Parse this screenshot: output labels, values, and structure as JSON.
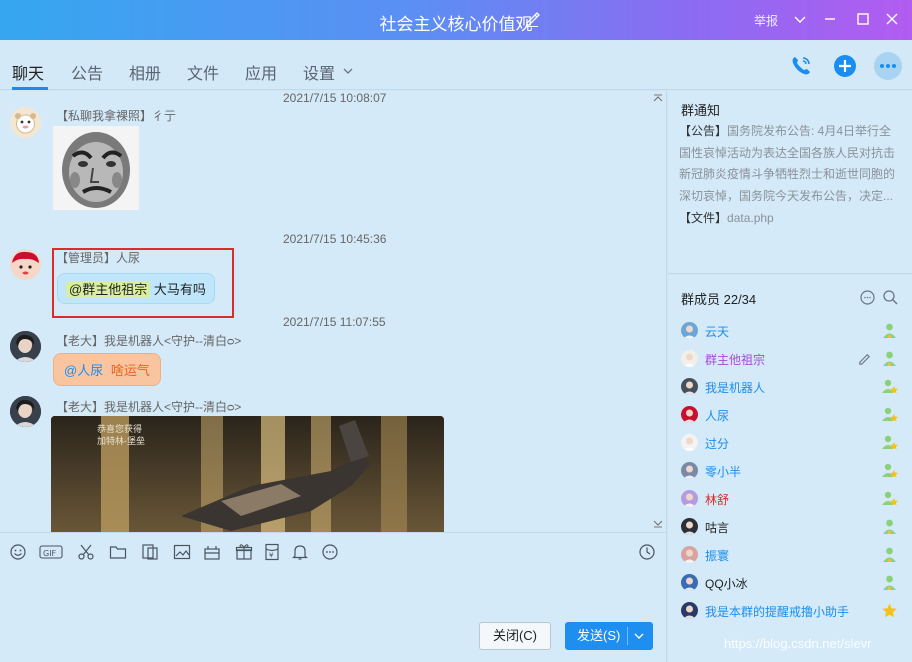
{
  "titlebar": {
    "title": "社会主义核心价值观",
    "report": "举报",
    "colors": {
      "gradient_start": "#35a7f0",
      "gradient_end": "#b25cf0"
    }
  },
  "tabs": [
    {
      "label": "聊天",
      "active": true
    },
    {
      "label": "公告"
    },
    {
      "label": "相册"
    },
    {
      "label": "文件"
    },
    {
      "label": "应用"
    },
    {
      "label": "设置"
    }
  ],
  "chat": {
    "messages": [
      {
        "time": "2021/7/15 10:08:07",
        "sender": "【私聊我拿裸照】彳亍",
        "type": "sticker"
      },
      {
        "time": "2021/7/15 10:45:36",
        "sender": "【管理员】人尿",
        "mention": "@群主他祖宗",
        "text": "大马有吗"
      },
      {
        "time": "2021/7/15 11:07:55",
        "sender": "【老大】我是机器人<守护--清白ᴑ>",
        "mention": "@人尿",
        "text": "啥运气"
      },
      {
        "sender": "【老大】我是机器人<守护--清白ᴑ>",
        "type": "image",
        "image_caption_1": "恭喜您获得",
        "image_caption_2": "加特林-堡垒"
      }
    ]
  },
  "toolbar_icons": [
    "emoji-icon",
    "gif-icon",
    "scissors-icon",
    "folder-icon",
    "screenshot-icon",
    "image-icon",
    "gift-box-icon",
    "present-icon",
    "red-packet-icon",
    "bell-icon",
    "more-icon",
    "history-icon"
  ],
  "buttons": {
    "close": "关闭(C)",
    "send": "发送(S)"
  },
  "notice": {
    "title": "群通知",
    "announcement_tag": "【公告】",
    "announcement_text": "国务院发布公告: 4月4日举行全国性哀悼活动为表达全国各族人民对抗击新冠肺炎疫情斗争牺牲烈士和逝世同胞的深切哀悼，国务院今天发布公告，决定...",
    "file_tag": "【文件】",
    "file_name": "data.php"
  },
  "members": {
    "title": "群成员 22/34",
    "list": [
      {
        "name": "云天",
        "color": "#1a8ef0"
      },
      {
        "name": "群主他祖宗",
        "color": "#a34bd6"
      },
      {
        "name": "我是机器人",
        "color": "#1a8ef0"
      },
      {
        "name": "人尿",
        "color": "#1a8ef0"
      },
      {
        "name": "过分",
        "color": "#1a8ef0"
      },
      {
        "name": "零小半",
        "color": "#1a8ef0"
      },
      {
        "name": "林舒",
        "color": "#e0262a"
      },
      {
        "name": "咕言",
        "color": "#222222"
      },
      {
        "name": "振寰",
        "color": "#1a8ef0"
      },
      {
        "name": "QQ小冰",
        "color": "#222222"
      },
      {
        "name": "我是本群的提醒戒撸小助手",
        "color": "#1a8ef0"
      }
    ]
  },
  "watermark": "https://blog.csdn.net/slevr"
}
